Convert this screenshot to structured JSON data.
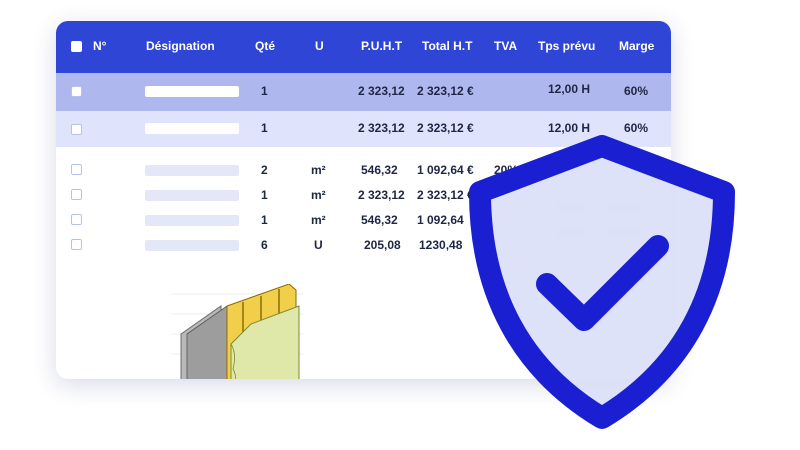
{
  "header": {
    "columns": [
      "N°",
      "Désignation",
      "Qté",
      "U",
      "P.U.H.T",
      "Total H.T",
      "TVA",
      "Tps prévu",
      "Marge"
    ]
  },
  "highlighted_rows": [
    {
      "qty": "1",
      "unit_price": "2 323,12",
      "total": "2 323,12 €",
      "time": "12,00 H",
      "margin": "60%"
    },
    {
      "qty": "1",
      "unit_price": "2 323,12",
      "total": "2 323,12 €",
      "time": "12,00 H",
      "margin": "60%"
    }
  ],
  "rows": [
    {
      "qty": "2",
      "unit": "m²",
      "unit_price": "546,32",
      "total": "1 092,64 €",
      "tva": "20%"
    },
    {
      "qty": "1",
      "unit": "m²",
      "unit_price": "2 323,12",
      "total": "2 323,12 €",
      "tva": ""
    },
    {
      "qty": "1",
      "unit": "m²",
      "unit_price": "546,32",
      "total": "1 092,64",
      "tva": ""
    },
    {
      "qty": "6",
      "unit": "U",
      "unit_price": "205,08",
      "total": "1230,48",
      "tva": ""
    }
  ],
  "colors": {
    "header_bg": "#2f45d6",
    "row_highlight_1": "#aeb8ee",
    "row_highlight_2": "#dfe3fb",
    "shield_stroke": "#1a1fd1",
    "shield_fill": "#dbe0f8"
  },
  "icons": [
    "checkbox-icon",
    "shield-check-icon",
    "wall-insulation-illustration"
  ]
}
